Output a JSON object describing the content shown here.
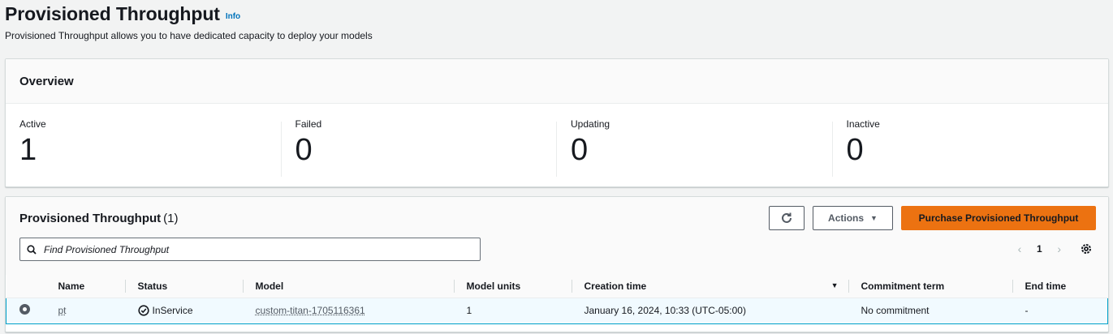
{
  "header": {
    "title": "Provisioned Throughput",
    "info": "Info",
    "description": "Provisioned Throughput allows you to have dedicated capacity to deploy your models"
  },
  "overview": {
    "title": "Overview",
    "stats": [
      {
        "label": "Active",
        "value": "1"
      },
      {
        "label": "Failed",
        "value": "0"
      },
      {
        "label": "Updating",
        "value": "0"
      },
      {
        "label": "Inactive",
        "value": "0"
      }
    ]
  },
  "table": {
    "title": "Provisioned Throughput",
    "count": "(1)",
    "actions_label": "Actions",
    "purchase_label": "Purchase Provisioned Throughput",
    "search_placeholder": "Find Provisioned Throughput",
    "page": "1",
    "columns": [
      "Name",
      "Status",
      "Model",
      "Model units",
      "Creation time",
      "Commitment term",
      "End time"
    ],
    "rows": [
      {
        "name": "pt",
        "status": "InService",
        "model": "custom-titan-1705116361",
        "model_units": "1",
        "creation_time": "January 16, 2024, 10:33 (UTC-05:00)",
        "commitment_term": "No commitment",
        "end_time": "-"
      }
    ]
  },
  "colors": {
    "accent": "#ec7211",
    "link": "#0073bb",
    "selection": "#00a1c9",
    "background": "#f2f3f3"
  },
  "icons": [
    "refresh-icon",
    "caret-down-icon",
    "search-icon",
    "chevron-left-icon",
    "chevron-right-icon",
    "gear-icon",
    "check-circle-icon",
    "sort-descending-icon"
  ]
}
